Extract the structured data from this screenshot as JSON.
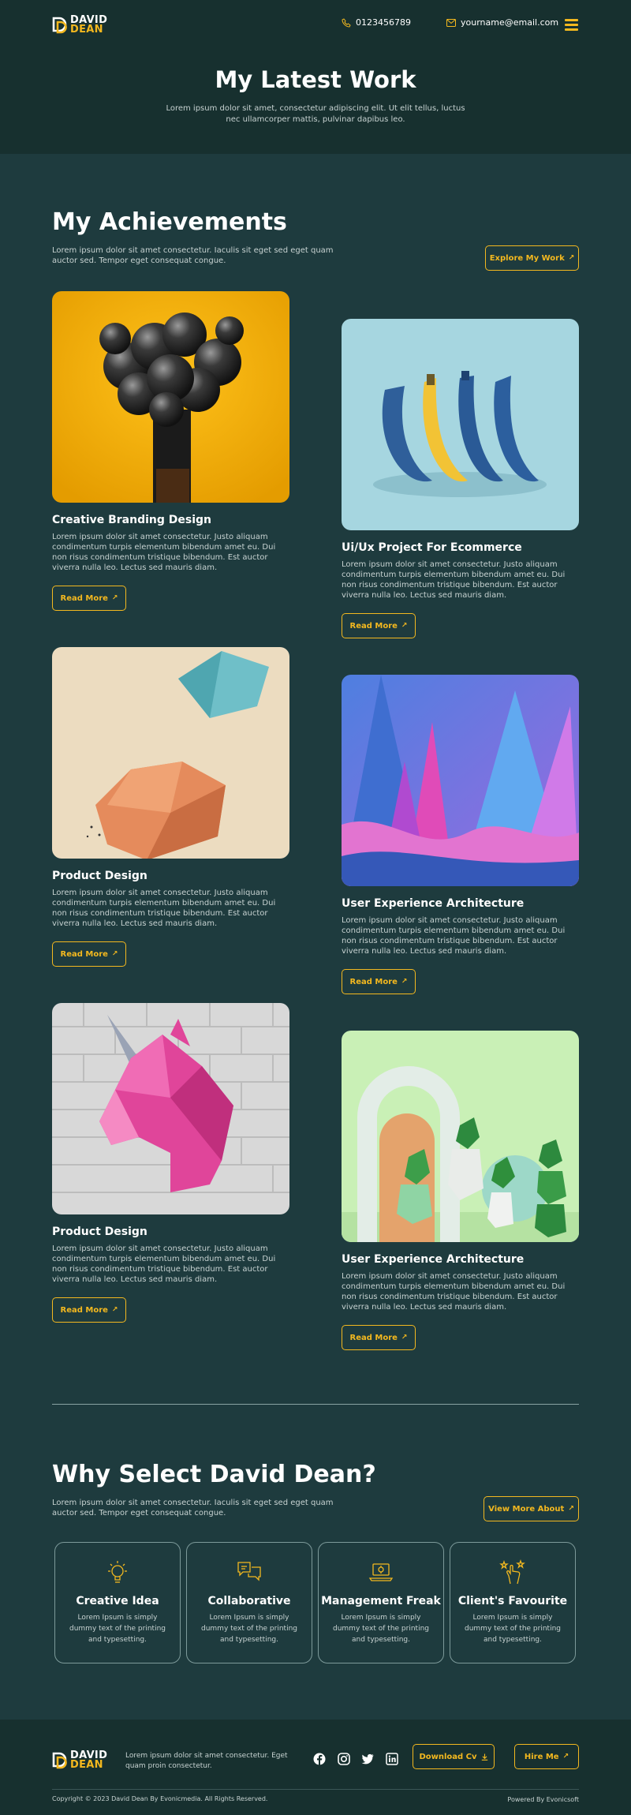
{
  "header": {
    "logo": {
      "line1": "DAVID",
      "line2": "DEAN"
    },
    "phone": "0123456789",
    "email": "yourname@email.com",
    "menu_icon": "hamburger-menu-icon",
    "title": "My Latest Work",
    "subtitle": "Lorem ipsum dolor sit amet, consectetur adipiscing elit. Ut elit tellus, luctus nec ullamcorper mattis, pulvinar dapibus leo."
  },
  "achievements": {
    "title": "My Achievements",
    "description": "Lorem ipsum dolor sit amet consectetur. Iaculis sit eget sed eget quam auctor sed. Tempor eget consequat congue.",
    "button": "Explore My Work",
    "cards": [
      {
        "title": "Creative Branding Design",
        "text": "Lorem ipsum dolor sit amet consectetur. Justo aliquam condimentum turpis elementum bibendum amet eu. Dui non risus condimentum tristique bibendum. Est auctor viverra nulla leo. Lectus sed mauris diam.",
        "button": "Read More"
      },
      {
        "title": "Ui/Ux Project For Ecommerce",
        "text": "Lorem ipsum dolor sit amet consectetur. Justo aliquam condimentum turpis elementum bibendum amet eu. Dui non risus condimentum tristique bibendum. Est auctor viverra nulla leo. Lectus sed mauris diam.",
        "button": "Read More"
      },
      {
        "title": "Product Design",
        "text": "Lorem ipsum dolor sit amet consectetur. Justo aliquam condimentum turpis elementum bibendum amet eu. Dui non risus condimentum tristique bibendum. Est auctor viverra nulla leo. Lectus sed mauris diam.",
        "button": "Read More"
      },
      {
        "title": "User Experience Architecture",
        "text": "Lorem ipsum dolor sit amet consectetur. Justo aliquam condimentum turpis elementum bibendum amet eu. Dui non risus condimentum tristique bibendum. Est auctor viverra nulla leo. Lectus sed mauris diam.",
        "button": "Read More"
      },
      {
        "title": "Product Design",
        "text": "Lorem ipsum dolor sit amet consectetur. Justo aliquam condimentum turpis elementum bibendum amet eu. Dui non risus condimentum tristique bibendum. Est auctor viverra nulla leo. Lectus sed mauris diam.",
        "button": "Read More"
      },
      {
        "title": "User Experience Architecture",
        "text": "Lorem ipsum dolor sit amet consectetur. Justo aliquam condimentum turpis elementum bibendum amet eu. Dui non risus condimentum tristique bibendum. Est auctor viverra nulla leo. Lectus sed mauris diam.",
        "button": "Read More"
      }
    ]
  },
  "why": {
    "title": "Why Select David Dean?",
    "description": "Lorem ipsum dolor sit amet consectetur. Iaculis sit eget sed eget quam auctor sed. Tempor eget consequat congue.",
    "button": "View More About",
    "features": [
      {
        "title": "Creative Idea",
        "text": "Lorem Ipsum is simply dummy text of the printing and typesetting.",
        "icon": "lightbulb-icon"
      },
      {
        "title": "Collaborative",
        "text": "Lorem Ipsum is simply dummy text of the printing and typesetting.",
        "icon": "chat-bubbles-icon"
      },
      {
        "title": "Management Freak",
        "text": "Lorem Ipsum is simply dummy text of the printing and typesetting.",
        "icon": "laptop-icon"
      },
      {
        "title": "Client's Favourite",
        "text": "Lorem Ipsum is simply dummy text of the printing and typesetting.",
        "icon": "hand-stars-icon"
      }
    ]
  },
  "footer": {
    "logo": {
      "line1": "DAVID",
      "line2": "DEAN"
    },
    "description": "Lorem ipsum dolor sit amet consectetur. Eget quam proin consectetur.",
    "social": [
      "facebook-icon",
      "instagram-icon",
      "twitter-icon",
      "linkedin-icon"
    ],
    "download_button": "Download Cv",
    "hire_button": "Hire Me",
    "copyright": "Copyright © 2023 David Dean By Evonicmedia. All Rights Reserved.",
    "powered": "Powered By Evonicsoft"
  },
  "colors": {
    "accent": "#f3b81f",
    "background": "#1e3b3e",
    "header_bg": "#17302f"
  }
}
